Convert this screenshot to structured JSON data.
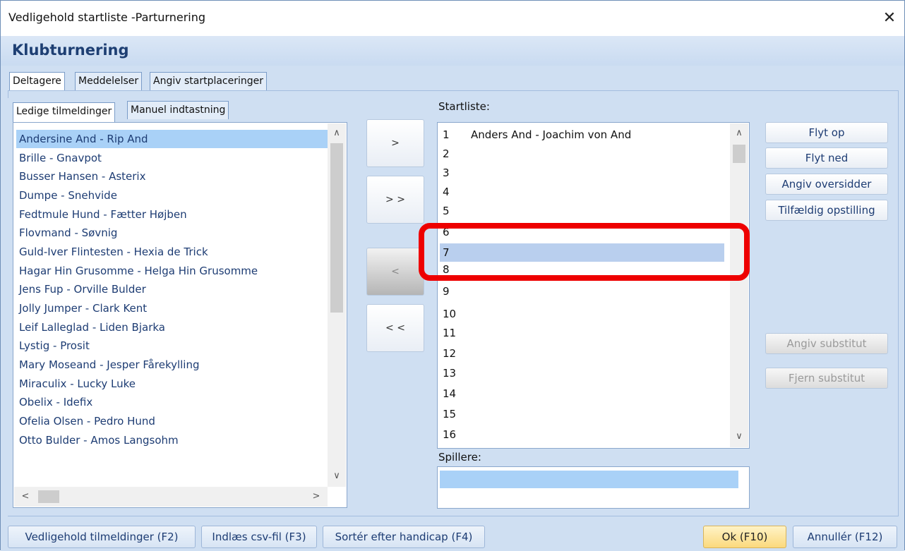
{
  "window": {
    "title": "Vedligehold startliste -Parturnering",
    "close_glyph": "✕"
  },
  "page_title": "Klubturnering",
  "main_tabs": [
    {
      "label": "Deltagere"
    },
    {
      "label": "Meddelelser"
    },
    {
      "label": "Angiv startplaceringer"
    }
  ],
  "sub_tabs": [
    {
      "label": "Ledige tilmeldinger"
    },
    {
      "label": "Manuel indtastning"
    }
  ],
  "available": [
    "Andersine And - Rip And",
    "Brille - Gnavpot",
    "Busser Hansen - Asterix",
    "Dumpe - Snehvide",
    "Fedtmule Hund - Fætter Højben",
    "Flovmand - Søvnig",
    "Guld-Iver Flintesten - Hexia de Trick",
    "Hagar Hin Grusomme - Helga Hin Grusomme",
    "Jens Fup - Orville Bulder",
    "Jolly Jumper - Clark Kent",
    "Leif Lalleglad - Liden Bjarka",
    "Lystig - Prosit",
    "Mary Moseand - Jesper Fårekylling",
    "Miraculix - Lucky Luke",
    "Obelix - Idefix",
    "Ofelia Olsen - Pedro Hund",
    "Otto Bulder - Amos Langsohm"
  ],
  "move_buttons": {
    "add": ">",
    "add_all": "> >",
    "remove": "<",
    "remove_all": "< <"
  },
  "startliste": {
    "label": "Startliste:",
    "slots": [
      {
        "num": "1",
        "name": "Anders And - Joachim von And"
      },
      {
        "num": "2",
        "name": ""
      },
      {
        "num": "3",
        "name": ""
      },
      {
        "num": "4",
        "name": ""
      },
      {
        "num": "5",
        "name": ""
      },
      {
        "num": "6",
        "name": ""
      },
      {
        "num": "7",
        "name": ""
      },
      {
        "num": "8",
        "name": ""
      },
      {
        "num": "9",
        "name": ""
      },
      {
        "num": "10",
        "name": ""
      },
      {
        "num": "11",
        "name": ""
      },
      {
        "num": "12",
        "name": ""
      },
      {
        "num": "13",
        "name": ""
      },
      {
        "num": "14",
        "name": ""
      },
      {
        "num": "15",
        "name": ""
      },
      {
        "num": "16",
        "name": ""
      }
    ]
  },
  "spillere": {
    "label": "Spillere:"
  },
  "side_buttons": {
    "flyt_op": "Flyt op",
    "flyt_ned": "Flyt ned",
    "angiv_oversidder": "Angiv oversidder",
    "tilfaeldig": "Tilfældig opstilling",
    "angiv_substitut": "Angiv substitut",
    "fjern_substitut": "Fjern substitut"
  },
  "footer": {
    "vedligehold": "Vedligehold tilmeldinger (F2)",
    "indlaes": "Indlæs csv-fil (F3)",
    "sorter": "Sortér efter handicap (F4)",
    "ok": "Ok (F10)",
    "annuller": "Annullér (F12)"
  },
  "scroll_glyphs": {
    "up": "∧",
    "down": "∨",
    "left": "<",
    "right": ">"
  }
}
